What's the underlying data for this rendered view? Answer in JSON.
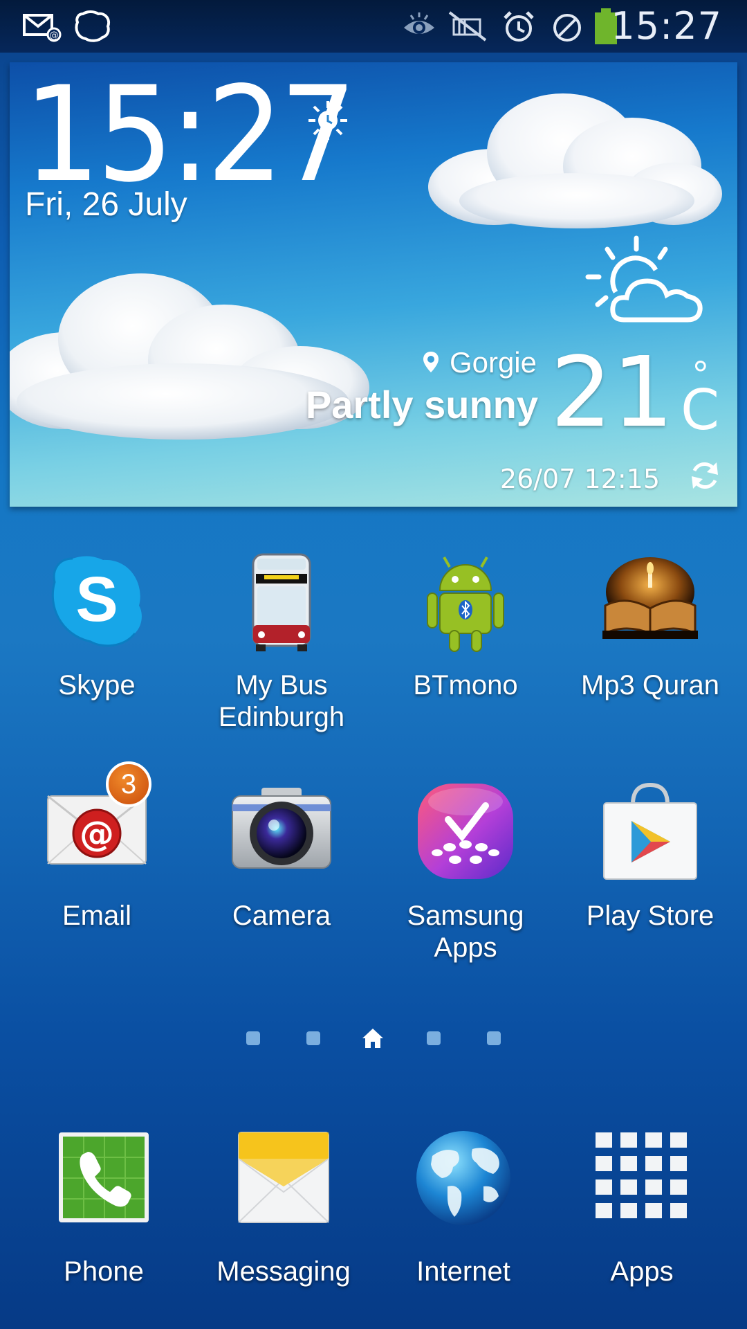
{
  "status_bar": {
    "time": "15:27",
    "icons": [
      "email-notification-icon",
      "skype-notification-icon",
      "smart-stay-eye-icon",
      "mute-icon",
      "alarm-icon",
      "blocking-mode-icon",
      "battery-icon"
    ]
  },
  "weather_widget": {
    "time": "15:27",
    "date": "Fri, 26 July",
    "location": "Gorgie",
    "condition": "Partly sunny",
    "temperature": "21",
    "degree": "°",
    "unit": "C",
    "updated": "26/07 12:15"
  },
  "apps": [
    {
      "label": "Skype",
      "icon": "skype-icon"
    },
    {
      "label": "My Bus Edinburgh",
      "icon": "bus-icon"
    },
    {
      "label": "BTmono",
      "icon": "android-bluetooth-icon"
    },
    {
      "label": "Mp3 Quran",
      "icon": "quran-book-icon"
    },
    {
      "label": "Email",
      "icon": "email-icon",
      "badge": "3"
    },
    {
      "label": "Camera",
      "icon": "camera-icon"
    },
    {
      "label": "Samsung Apps",
      "icon": "samsung-apps-icon"
    },
    {
      "label": "Play Store",
      "icon": "play-store-icon"
    }
  ],
  "page_indicator": {
    "pages": 5,
    "current": 3
  },
  "dock": [
    {
      "label": "Phone",
      "icon": "phone-icon"
    },
    {
      "label": "Messaging",
      "icon": "messaging-icon"
    },
    {
      "label": "Internet",
      "icon": "globe-icon"
    },
    {
      "label": "Apps",
      "icon": "apps-grid-icon"
    }
  ],
  "colors": {
    "background": "#1577c4",
    "status_bar": "#06275a",
    "badge": "#e0661a"
  }
}
